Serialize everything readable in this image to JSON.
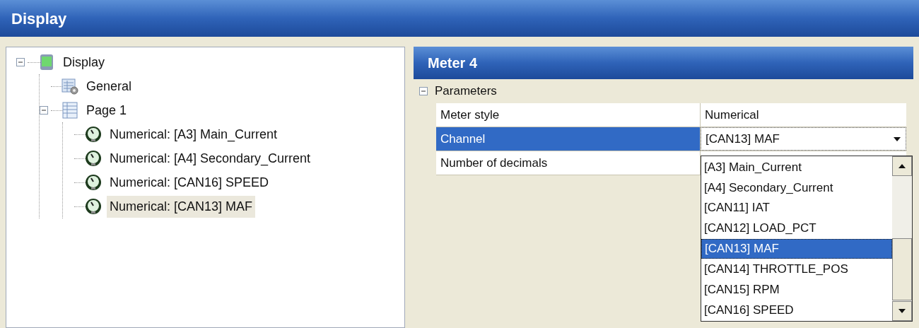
{
  "window": {
    "title": "Display"
  },
  "tree": [
    {
      "label": "Display",
      "kind": "display",
      "expanded": true,
      "selected": false,
      "children": [
        {
          "label": "General",
          "kind": "general",
          "selected": false
        },
        {
          "label": "Page 1",
          "kind": "page",
          "expanded": true,
          "selected": false,
          "children": [
            {
              "label": "Numerical: [A3] Main_Current",
              "kind": "meter",
              "selected": false
            },
            {
              "label": "Numerical: [A4] Secondary_Current",
              "kind": "meter",
              "selected": false
            },
            {
              "label": "Numerical: [CAN16] SPEED",
              "kind": "meter",
              "selected": false
            },
            {
              "label": "Numerical: [CAN13] MAF",
              "kind": "meter",
              "selected": true
            }
          ]
        }
      ]
    }
  ],
  "panel": {
    "title": "Meter 4",
    "category": {
      "label": "Parameters",
      "expanded": true
    },
    "properties": [
      {
        "name": "Meter style",
        "value": "Numerical",
        "selected": false,
        "kind": "text"
      },
      {
        "name": "Channel",
        "value": "[CAN13] MAF",
        "selected": true,
        "kind": "dropdown"
      },
      {
        "name": "Number of decimals",
        "selected": false,
        "kind": "text"
      }
    ],
    "dropdown": {
      "open": true,
      "options": [
        {
          "label": "[A3] Main_Current",
          "selected": false
        },
        {
          "label": "[A4] Secondary_Current",
          "selected": false
        },
        {
          "label": "[CAN11] IAT",
          "selected": false
        },
        {
          "label": "[CAN12] LOAD_PCT",
          "selected": false
        },
        {
          "label": "[CAN13] MAF",
          "selected": true
        },
        {
          "label": "[CAN14] THROTTLE_POS",
          "selected": false
        },
        {
          "label": "[CAN15] RPM",
          "selected": false
        },
        {
          "label": "[CAN16] SPEED",
          "selected": false
        }
      ]
    }
  }
}
